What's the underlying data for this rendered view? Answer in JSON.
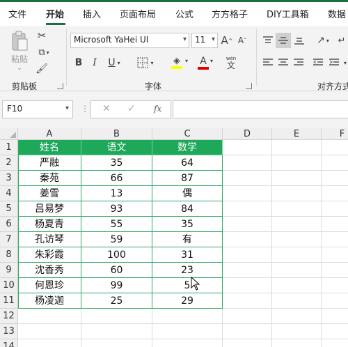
{
  "tabs": [
    "文件",
    "开始",
    "插入",
    "页面布局",
    "公式",
    "方方格子",
    "DIY工具箱",
    "数据"
  ],
  "active_tab": "开始",
  "ribbon": {
    "clipboard": {
      "paste_label": "粘贴",
      "group_label": "剪贴板"
    },
    "font": {
      "font_name": "Microsoft YaHei UI",
      "font_size": "11",
      "grow_label": "A",
      "shrink_label": "A",
      "bold": "B",
      "italic": "I",
      "underline": "U",
      "fill_label": "",
      "color_label": "A",
      "phonetic_label": "wén",
      "group_label": "字体",
      "fill_color": "#ffff00",
      "font_color": "#e00000"
    },
    "alignment": {
      "group_label": "对齐方式"
    }
  },
  "formula_bar": {
    "name_box": "F10",
    "fx_label": "fx",
    "formula": ""
  },
  "sheet": {
    "columns": [
      "A",
      "B",
      "C",
      "D",
      "E",
      "F"
    ],
    "rows": [
      "1",
      "2",
      "3",
      "4",
      "5",
      "6",
      "7",
      "8",
      "9",
      "10",
      "11",
      "12",
      "13",
      "14"
    ],
    "table_header": [
      "姓名",
      "语文",
      "数学"
    ],
    "table_rows": [
      [
        "严融",
        "35",
        "64"
      ],
      [
        "秦苑",
        "66",
        "87"
      ],
      [
        "姜雪",
        "13",
        "偶"
      ],
      [
        "吕易梦",
        "93",
        "84"
      ],
      [
        "杨夏青",
        "55",
        "35"
      ],
      [
        "孔访琴",
        "59",
        "有"
      ],
      [
        "朱彩霞",
        "100",
        "31"
      ],
      [
        "沈香秀",
        "60",
        "23"
      ],
      [
        "何恩珍",
        "99",
        "5"
      ],
      [
        "杨凌迦",
        "25",
        "29"
      ]
    ],
    "header_color": "#1da85a",
    "accent_color": "#1e6f3e"
  }
}
